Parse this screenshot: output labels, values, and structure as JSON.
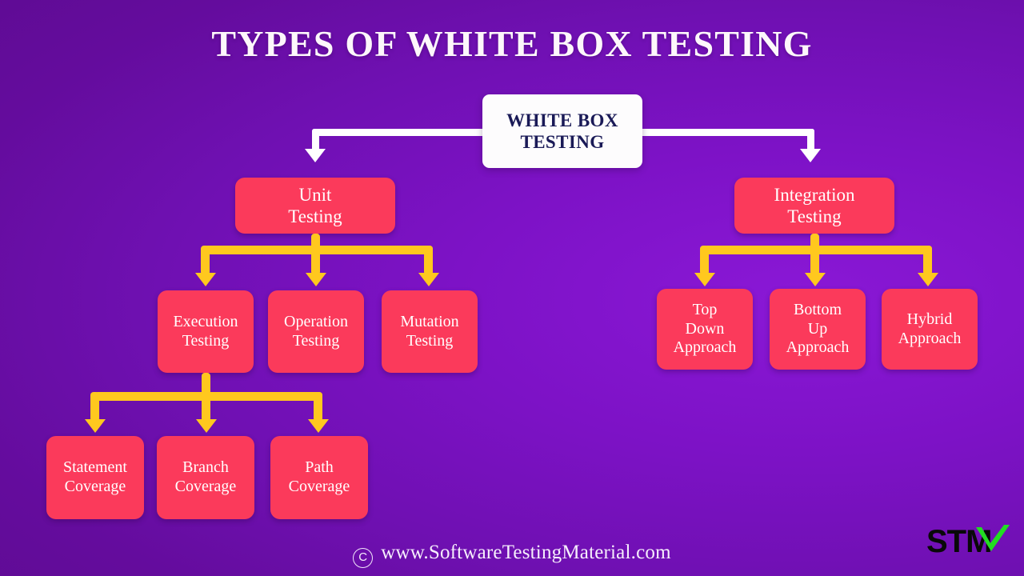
{
  "page": {
    "title": "TYPES OF WHITE BOX TESTING",
    "background_color_start": "#8a18d6",
    "background_color_end": "#5b0a8c"
  },
  "diagram": {
    "type": "tree",
    "root": {
      "label": "WHITE BOX\nTESTING",
      "text_color": "#1a1a57",
      "fill_color": "#fdfcfd"
    },
    "node_fill_color": "#fb3a5b",
    "node_text_color": "#ffffff",
    "root_connector_color": "#ffffff",
    "branch_connector_color": "#ffc81e",
    "level2": [
      {
        "label": "Unit\nTesting"
      },
      {
        "label": "Integration\nTesting"
      }
    ],
    "unit_children": [
      {
        "label": "Execution\nTesting"
      },
      {
        "label": "Operation\nTesting"
      },
      {
        "label": "Mutation\nTesting"
      }
    ],
    "integration_children": [
      {
        "label": "Top\nDown\nApproach"
      },
      {
        "label": "Bottom\nUp\nApproach"
      },
      {
        "label": "Hybrid\nApproach"
      }
    ],
    "execution_children": [
      {
        "label": "Statement\nCoverage"
      },
      {
        "label": "Branch\nCoverage"
      },
      {
        "label": "Path\nCoverage"
      }
    ]
  },
  "footer": {
    "copyright_symbol": "C",
    "website": "www.SoftwareTestingMaterial.com"
  },
  "logo": {
    "text": "STM",
    "check_color": "#22dd22",
    "text_color": "#090909"
  }
}
